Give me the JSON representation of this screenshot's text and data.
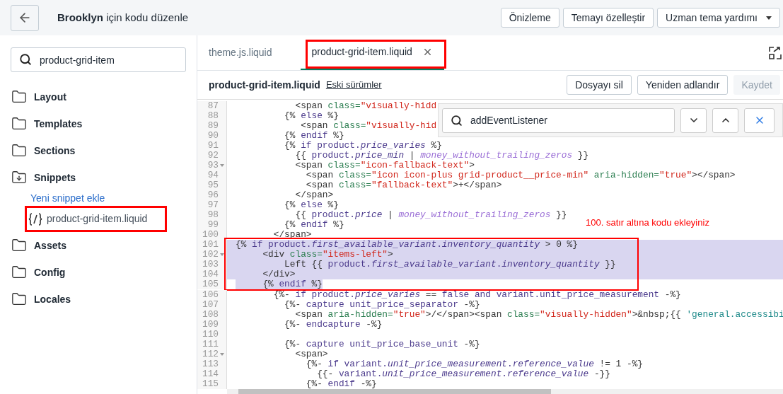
{
  "header": {
    "title": "**Brooklyn** için kodu düzenle",
    "buttons": [
      {
        "label": "Önizleme",
        "dropdown": false
      },
      {
        "label": "Temayı özelleştir",
        "dropdown": false
      },
      {
        "label": "Uzman tema yardımı",
        "dropdown": true
      }
    ]
  },
  "sidebar": {
    "search": {
      "value": "product-grid-item"
    },
    "folders": [
      {
        "label": "Layout",
        "expanded": false
      },
      {
        "label": "Templates",
        "expanded": false
      },
      {
        "label": "Sections",
        "expanded": false
      },
      {
        "label": "Snippets",
        "expanded": true,
        "children": [
          {
            "kind": "action",
            "label": "Yeni snippet ekle"
          },
          {
            "kind": "file",
            "label": "product-grid-item.liquid",
            "marked": true
          }
        ]
      },
      {
        "label": "Assets",
        "expanded": false
      },
      {
        "label": "Config",
        "expanded": false
      },
      {
        "label": "Locales",
        "expanded": false
      }
    ]
  },
  "tabs": [
    {
      "label": "theme.js.liquid",
      "selected": false,
      "closable": false,
      "marked": false
    },
    {
      "label": "product-grid-item.liquid",
      "selected": true,
      "closable": true,
      "marked": true
    }
  ],
  "file": {
    "name": "product-grid-item.liquid",
    "history_link": "Eski sürümler",
    "buttons": [
      {
        "label": "Dosyayı sil",
        "disabled": false
      },
      {
        "label": "Yeniden adlandır",
        "disabled": false
      },
      {
        "label": "Kaydet",
        "disabled": true
      }
    ]
  },
  "find": {
    "value": "addEventListener"
  },
  "note": "100. satır altına kodu ekleyiniz",
  "code_blocks": [
    {
      "kind": "plain",
      "lines": [
        {
          "number": "87",
          "foldable": false,
          "tokens": [
            {
              "text": "           <span ",
              "kind": "plain"
            },
            {
              "text": "class=",
              "kind": "attr"
            },
            {
              "text": "\"visually-hidd",
              "kind": "str"
            }
          ]
        },
        {
          "number": "88",
          "foldable": false,
          "tokens": [
            {
              "text": "         {% ",
              "kind": "plain"
            },
            {
              "text": "else",
              "kind": "kw"
            },
            {
              "text": " %}",
              "kind": "plain"
            }
          ]
        },
        {
          "number": "89",
          "foldable": false,
          "tokens": [
            {
              "text": "            <span ",
              "kind": "plain"
            },
            {
              "text": "class=",
              "kind": "attr"
            },
            {
              "text": "\"visually-hid",
              "kind": "str"
            }
          ]
        },
        {
          "number": "90",
          "foldable": false,
          "tokens": [
            {
              "text": "         {% ",
              "kind": "plain"
            },
            {
              "text": "endif",
              "kind": "kw"
            },
            {
              "text": " %}",
              "kind": "plain"
            }
          ]
        },
        {
          "number": "91",
          "foldable": false,
          "tokens": [
            {
              "text": "         {% ",
              "kind": "plain"
            },
            {
              "text": "if",
              "kind": "kw"
            },
            {
              "text": " product.",
              "kind": "obj"
            },
            {
              "text": "price_varies",
              "kind": "prop"
            },
            {
              "text": " %}",
              "kind": "plain"
            }
          ]
        },
        {
          "number": "92",
          "foldable": false,
          "tokens": [
            {
              "text": "           {{ ",
              "kind": "plain"
            },
            {
              "text": "product.",
              "kind": "obj"
            },
            {
              "text": "price_min",
              "kind": "prop"
            },
            {
              "text": " | ",
              "kind": "plain"
            },
            {
              "text": "money_without_trailing_zeros",
              "kind": "filter"
            },
            {
              "text": " }}",
              "kind": "plain"
            }
          ]
        },
        {
          "number": "93",
          "foldable": true,
          "tokens": [
            {
              "text": "           <span ",
              "kind": "plain"
            },
            {
              "text": "class=",
              "kind": "attr"
            },
            {
              "text": "\"icon-fallback-text\"",
              "kind": "str"
            },
            {
              "text": ">",
              "kind": "plain"
            }
          ]
        },
        {
          "number": "94",
          "foldable": false,
          "tokens": [
            {
              "text": "             <span ",
              "kind": "plain"
            },
            {
              "text": "class=",
              "kind": "attr"
            },
            {
              "text": "\"icon icon-plus grid-product__price-min\"",
              "kind": "str"
            },
            {
              "text": " aria-hidden=",
              "kind": "attr"
            },
            {
              "text": "\"true\"",
              "kind": "str"
            },
            {
              "text": "></span>",
              "kind": "plain"
            }
          ]
        },
        {
          "number": "95",
          "foldable": false,
          "tokens": [
            {
              "text": "             <span ",
              "kind": "plain"
            },
            {
              "text": "class=",
              "kind": "attr"
            },
            {
              "text": "\"fallback-text\"",
              "kind": "str"
            },
            {
              "text": ">+</span>",
              "kind": "plain"
            }
          ]
        },
        {
          "number": "96",
          "foldable": false,
          "tokens": [
            {
              "text": "           </span>",
              "kind": "plain"
            }
          ]
        },
        {
          "number": "97",
          "foldable": false,
          "tokens": [
            {
              "text": "         {% ",
              "kind": "plain"
            },
            {
              "text": "else",
              "kind": "kw"
            },
            {
              "text": " %}",
              "kind": "plain"
            }
          ]
        },
        {
          "number": "98",
          "foldable": false,
          "tokens": [
            {
              "text": "           {{ ",
              "kind": "plain"
            },
            {
              "text": "product.",
              "kind": "obj"
            },
            {
              "text": "price",
              "kind": "prop"
            },
            {
              "text": " | ",
              "kind": "plain"
            },
            {
              "text": "money_without_trailing_zeros",
              "kind": "filter"
            },
            {
              "text": " }}",
              "kind": "plain"
            }
          ]
        },
        {
          "number": "99",
          "foldable": false,
          "tokens": [
            {
              "text": "         {% ",
              "kind": "plain"
            },
            {
              "text": "endif",
              "kind": "kw"
            },
            {
              "text": " %}",
              "kind": "plain"
            }
          ]
        },
        {
          "number": "100",
          "foldable": false,
          "tokens": [
            {
              "text": "       </span>",
              "kind": "plain"
            }
          ]
        }
      ]
    },
    {
      "kind": "marked_selection",
      "lines": [
        {
          "number": "101",
          "foldable": false,
          "tokens": [
            {
              "text": "{% ",
              "kind": "plain"
            },
            {
              "text": "if",
              "kind": "kw"
            },
            {
              "text": " product.",
              "kind": "obj"
            },
            {
              "text": "first_available_variant",
              "kind": "prop"
            },
            {
              "text": ".",
              "kind": "obj"
            },
            {
              "text": "inventory_quantity",
              "kind": "prop"
            },
            {
              "text": " > 0 %}",
              "kind": "plain"
            }
          ]
        },
        {
          "number": "102",
          "foldable": true,
          "tokens": [
            {
              "text": "     <div ",
              "kind": "plain"
            },
            {
              "text": "class=",
              "kind": "attr"
            },
            {
              "text": "\"items-left\"",
              "kind": "str"
            },
            {
              "text": ">",
              "kind": "plain"
            }
          ]
        },
        {
          "number": "103",
          "foldable": false,
          "tokens": [
            {
              "text": "         Left {{ ",
              "kind": "plain"
            },
            {
              "text": "product.",
              "kind": "obj"
            },
            {
              "text": "first_available_variant",
              "kind": "prop"
            },
            {
              "text": ".",
              "kind": "obj"
            },
            {
              "text": "inventory_quantity",
              "kind": "prop"
            },
            {
              "text": " }}",
              "kind": "plain"
            }
          ]
        },
        {
          "number": "104",
          "foldable": false,
          "tokens": [
            {
              "text": "     </div>",
              "kind": "plain"
            }
          ]
        },
        {
          "number": "105",
          "foldable": false,
          "tokens": [
            {
              "text": "     {% ",
              "kind": "plain"
            },
            {
              "text": "endif",
              "kind": "kw"
            },
            {
              "text": " %}",
              "kind": "plain"
            }
          ]
        }
      ]
    },
    {
      "kind": "plain",
      "lines": [
        {
          "number": "106",
          "foldable": false,
          "tokens": [
            {
              "text": "       {%- ",
              "kind": "plain"
            },
            {
              "text": "if",
              "kind": "kw"
            },
            {
              "text": " product.",
              "kind": "obj"
            },
            {
              "text": "price_varies",
              "kind": "prop"
            },
            {
              "text": " == ",
              "kind": "plain"
            },
            {
              "text": "false",
              "kind": "kw"
            },
            {
              "text": " and",
              "kind": "kw"
            },
            {
              "text": " variant.unit_price_measurement ",
              "kind": "obj"
            },
            {
              "text": "-%}",
              "kind": "plain"
            }
          ]
        },
        {
          "number": "107",
          "foldable": false,
          "tokens": [
            {
              "text": "         {%- ",
              "kind": "plain"
            },
            {
              "text": "capture",
              "kind": "kw"
            },
            {
              "text": " unit_price_separator ",
              "kind": "obj"
            },
            {
              "text": "-%}",
              "kind": "plain"
            }
          ]
        },
        {
          "number": "108",
          "foldable": false,
          "tokens": [
            {
              "text": "           <span ",
              "kind": "plain"
            },
            {
              "text": "aria-hidden=",
              "kind": "attr"
            },
            {
              "text": "\"true\"",
              "kind": "str"
            },
            {
              "text": ">/</span><span ",
              "kind": "plain"
            },
            {
              "text": "class=",
              "kind": "attr"
            },
            {
              "text": "\"visually-hidden\"",
              "kind": "str"
            },
            {
              "text": ">&nbsp;{{ ",
              "kind": "plain"
            },
            {
              "text": "'general.accessibi",
              "kind": "quote"
            }
          ]
        },
        {
          "number": "109",
          "foldable": false,
          "tokens": [
            {
              "text": "         {%- ",
              "kind": "plain"
            },
            {
              "text": "endcapture",
              "kind": "kw"
            },
            {
              "text": " -%}",
              "kind": "plain"
            }
          ]
        },
        {
          "number": "110",
          "foldable": false
        },
        {
          "number": "111",
          "foldable": false,
          "tokens": [
            {
              "text": "         {%- ",
              "kind": "plain"
            },
            {
              "text": "capture",
              "kind": "kw"
            },
            {
              "text": " unit_price_base_unit ",
              "kind": "obj"
            },
            {
              "text": "-%}",
              "kind": "plain"
            }
          ]
        },
        {
          "number": "112",
          "foldable": true,
          "tokens": [
            {
              "text": "           <span>",
              "kind": "plain"
            }
          ]
        },
        {
          "number": "113",
          "foldable": false,
          "tokens": [
            {
              "text": "             {%- ",
              "kind": "plain"
            },
            {
              "text": "if",
              "kind": "kw"
            },
            {
              "text": " variant.",
              "kind": "obj"
            },
            {
              "text": "unit_price_measurement",
              "kind": "prop"
            },
            {
              "text": ".",
              "kind": "obj"
            },
            {
              "text": "reference_value",
              "kind": "prop"
            },
            {
              "text": " != 1 -%}",
              "kind": "plain"
            }
          ]
        },
        {
          "number": "114",
          "foldable": false,
          "tokens": [
            {
              "text": "               {{- ",
              "kind": "plain"
            },
            {
              "text": "variant.",
              "kind": "obj"
            },
            {
              "text": "unit_price_measurement",
              "kind": "prop"
            },
            {
              "text": ".",
              "kind": "obj"
            },
            {
              "text": "reference_value",
              "kind": "prop"
            },
            {
              "text": " -}}",
              "kind": "plain"
            }
          ]
        },
        {
          "number": "115",
          "foldable": false,
          "tokens": [
            {
              "text": "             {%- ",
              "kind": "plain"
            },
            {
              "text": "endif",
              "kind": "kw"
            },
            {
              "text": " -%}",
              "kind": "plain"
            }
          ]
        }
      ]
    }
  ]
}
